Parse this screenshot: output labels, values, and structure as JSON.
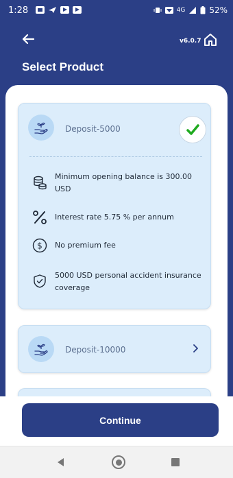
{
  "status_bar": {
    "time": "1:28",
    "network": "4G",
    "battery": "52%"
  },
  "header": {
    "version": "v6.0.7",
    "title": "Select Product",
    "back_icon": "arrow-left-icon",
    "home_icon": "home-icon"
  },
  "products": [
    {
      "name": "Deposit-5000",
      "selected": true,
      "features": [
        {
          "icon": "coins-icon",
          "text": "Minimum opening balance is 300.00 USD"
        },
        {
          "icon": "percent-icon",
          "text": "Interest rate 5.75 % per annum"
        },
        {
          "icon": "dollar-circle-icon",
          "text": "No premium fee"
        },
        {
          "icon": "shield-check-icon",
          "text": "5000 USD personal accident insurance coverage"
        }
      ]
    },
    {
      "name": "Deposit-10000",
      "selected": false
    }
  ],
  "footer": {
    "continue_label": "Continue"
  },
  "colors": {
    "primary": "#2b3f86",
    "card_bg": "#dcedfb",
    "check": "#1faa1f"
  }
}
